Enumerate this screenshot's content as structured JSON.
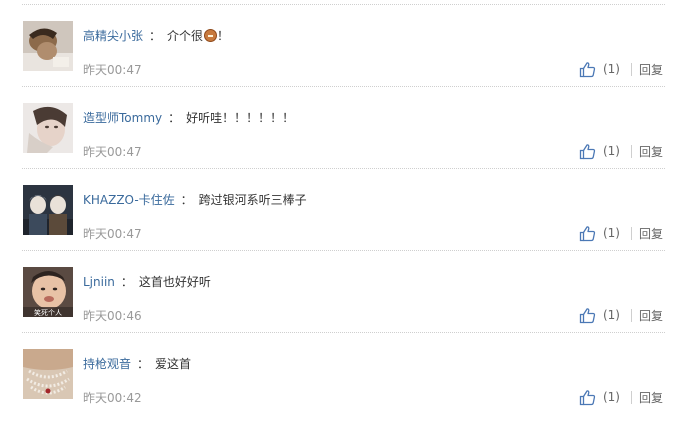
{
  "comments": [
    {
      "username": "高精尖小张",
      "separator": "：",
      "text": "介个很",
      "text_after_emoji": "！",
      "has_emoji": true,
      "emoji_name": "doge-emoji",
      "time": "昨天00:47",
      "like_count": "(1)",
      "reply_label": "回复"
    },
    {
      "username": "造型师Tommy",
      "separator": "：",
      "text": "好听哇！！！！！！",
      "has_emoji": false,
      "time": "昨天00:47",
      "like_count": "(1)",
      "reply_label": "回复"
    },
    {
      "username": "KHAZZO-卡住佐",
      "separator": "：",
      "text": "跨过银河系听三棒子",
      "has_emoji": false,
      "time": "昨天00:47",
      "like_count": "(1)",
      "reply_label": "回复"
    },
    {
      "username": "Ljniin",
      "separator": "：",
      "text": "这首也好好听",
      "has_emoji": false,
      "time": "昨天00:46",
      "like_count": "(1)",
      "reply_label": "回复",
      "avatar_caption": "笑死个人"
    },
    {
      "username": "持枪观音",
      "separator": "：",
      "text": "爱这首",
      "has_emoji": false,
      "time": "昨天00:42",
      "like_count": "(1)",
      "reply_label": "回复"
    }
  ],
  "colors": {
    "username": "#3a6a9c",
    "text": "#333333",
    "muted": "#999999",
    "icon": "#4b78b5"
  }
}
